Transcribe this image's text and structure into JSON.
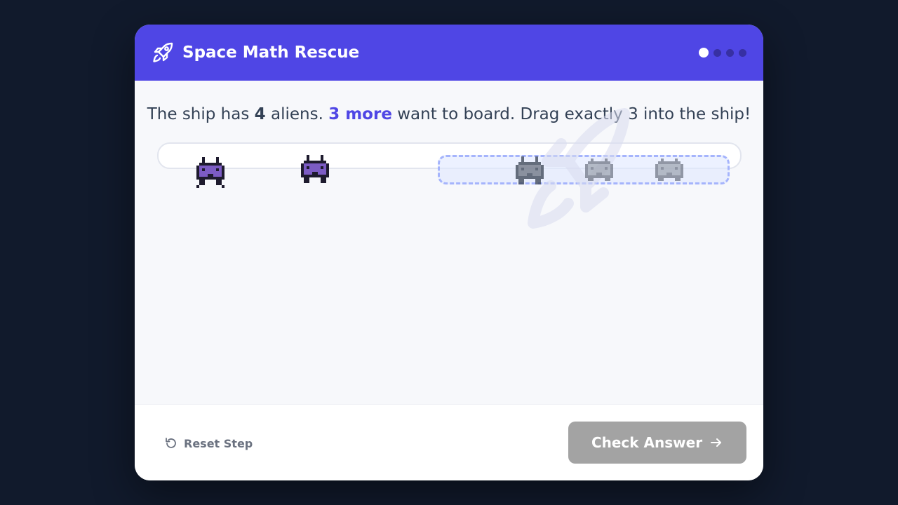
{
  "header": {
    "title": "Space Math Rescue",
    "icon": "rocket-icon",
    "progress": {
      "total_steps": 4,
      "current_step": 1
    }
  },
  "instruction": {
    "part1": "The ship has ",
    "count_aboard": "4",
    "part2": " aliens. ",
    "more": "3 more",
    "part3": " want to board. Drag exactly 3 into the ship!"
  },
  "aliens": {
    "draggable": [
      {
        "name": "alien-draggable-1",
        "state": "active"
      },
      {
        "name": "alien-draggable-2",
        "state": "active"
      }
    ],
    "in_ship": [
      {
        "name": "alien-in-ship-1",
        "state": "faded-dark"
      },
      {
        "name": "alien-in-ship-2",
        "state": "faded"
      },
      {
        "name": "alien-in-ship-3",
        "state": "faded"
      }
    ]
  },
  "footer": {
    "reset_label": "Reset Step",
    "check_label": "Check Answer"
  },
  "colors": {
    "background": "#111a2c",
    "header": "#4f46e5",
    "accent": "#4f46e5",
    "check_button_disabled": "#a3a3a3",
    "alien_purple": "#7c5cc4",
    "alien_gray": "#9ca3af"
  }
}
